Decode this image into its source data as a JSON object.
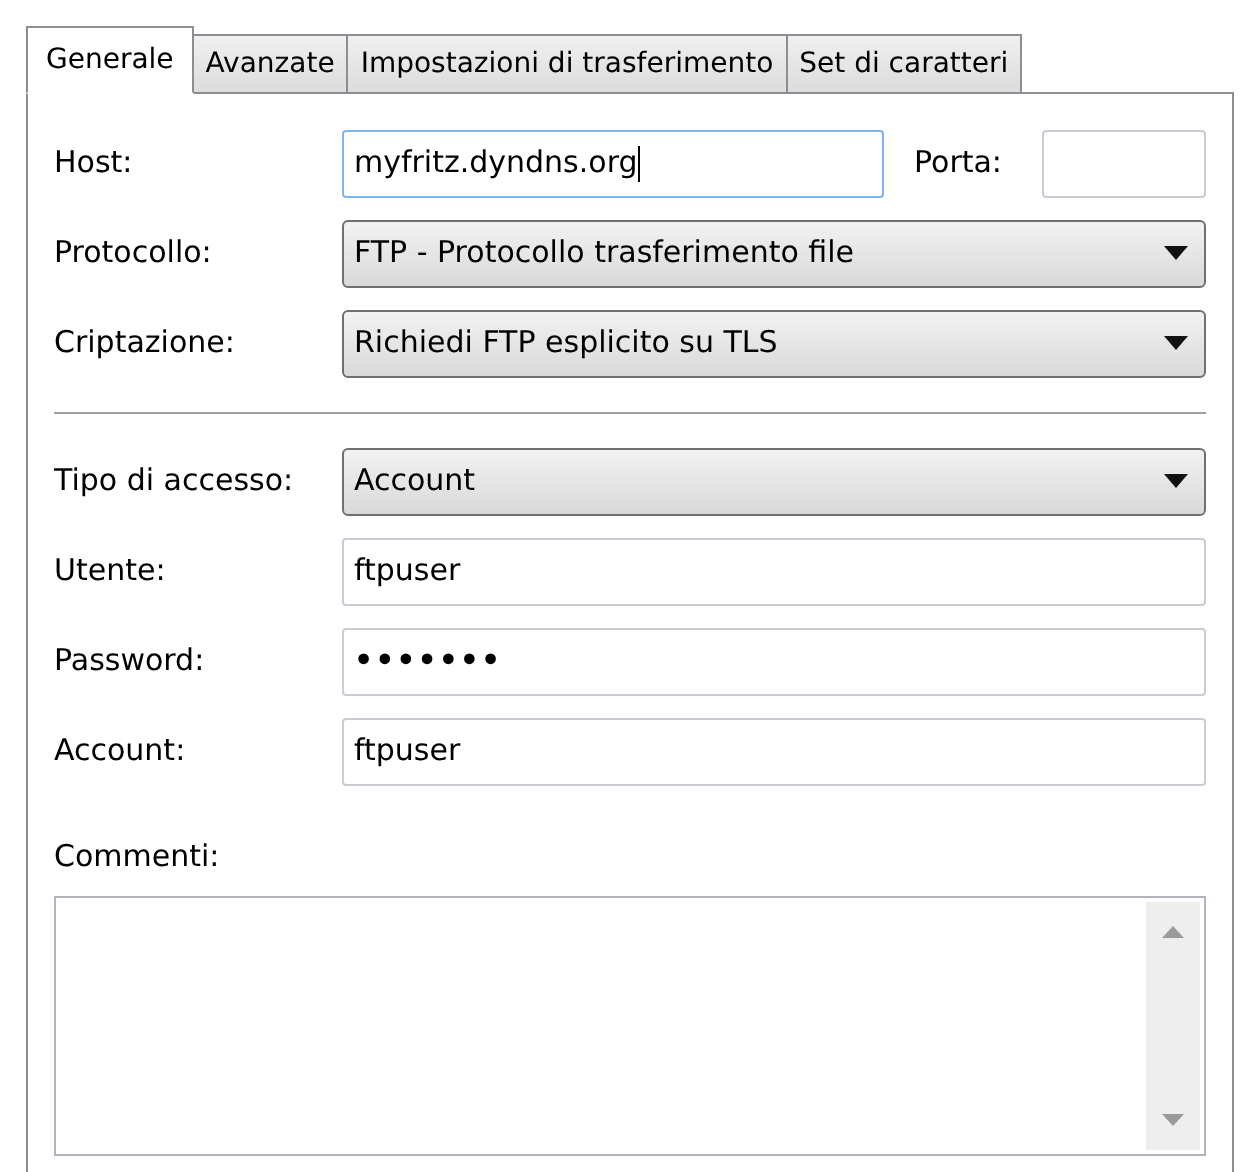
{
  "tabs": [
    {
      "label": "Generale",
      "selected": true
    },
    {
      "label": "Avanzate",
      "selected": false
    },
    {
      "label": "Impostazioni di trasferimento",
      "selected": false
    },
    {
      "label": "Set di caratteri",
      "selected": false
    }
  ],
  "host": {
    "label": "Host:",
    "value": "myfritz.dyndns.org",
    "focused": true
  },
  "port": {
    "label": "Porta:"
  },
  "rows_top": [
    {
      "kind": "dropdown",
      "label": "Protocollo:",
      "value": "FTP - Protocollo trasferimento file"
    },
    {
      "kind": "dropdown",
      "label": "Criptazione:",
      "value": "Richiedi FTP esplicito su TLS"
    }
  ],
  "rows_bottom": [
    {
      "kind": "dropdown",
      "label": "Tipo di accesso:",
      "value": "Account"
    },
    {
      "kind": "text",
      "label": "Utente:",
      "value": "ftpuser"
    },
    {
      "kind": "password",
      "label": "Password:",
      "value": "•••••••"
    },
    {
      "kind": "text",
      "label": "Account:",
      "value": "ftpuser"
    }
  ],
  "comments": {
    "label": "Commenti:"
  }
}
